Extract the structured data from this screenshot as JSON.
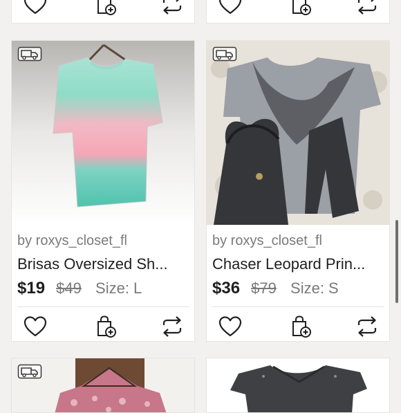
{
  "listings": [
    {
      "seller": "by roxys_closet_fl",
      "title": "Brisas Oversized Sh...",
      "price": "$19",
      "original_price": "$49",
      "size": "Size: L",
      "photo": "tie-dye-top"
    },
    {
      "seller": "by roxys_closet_fl",
      "title": "Chaser Leopard Prin...",
      "price": "$36",
      "original_price": "$79",
      "size": "Size: S",
      "photo": "gray-leopard-shirt"
    }
  ],
  "icons": {
    "shipping": "truck-icon",
    "like": "heart-icon",
    "bundle": "shopping-bag-plus-icon",
    "share": "repost-icon"
  },
  "colors": {
    "background": "#f2f1ef",
    "card": "#ffffff",
    "text": "#1f1f1f",
    "muted": "#7a7a7a"
  }
}
